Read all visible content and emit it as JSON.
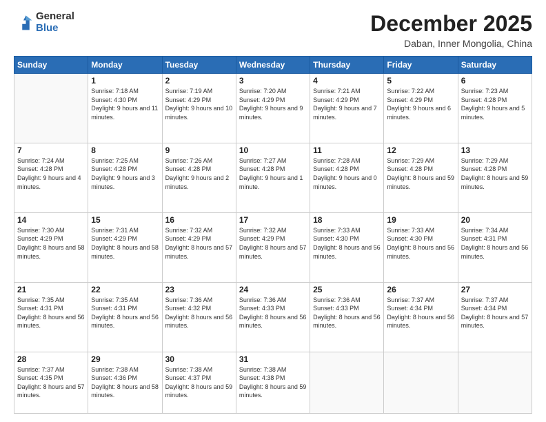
{
  "logo": {
    "general": "General",
    "blue": "Blue"
  },
  "header": {
    "month": "December 2025",
    "location": "Daban, Inner Mongolia, China"
  },
  "days_of_week": [
    "Sunday",
    "Monday",
    "Tuesday",
    "Wednesday",
    "Thursday",
    "Friday",
    "Saturday"
  ],
  "weeks": [
    [
      {
        "num": "",
        "sunrise": "",
        "sunset": "",
        "daylight": ""
      },
      {
        "num": "1",
        "sunrise": "Sunrise: 7:18 AM",
        "sunset": "Sunset: 4:30 PM",
        "daylight": "Daylight: 9 hours and 11 minutes."
      },
      {
        "num": "2",
        "sunrise": "Sunrise: 7:19 AM",
        "sunset": "Sunset: 4:29 PM",
        "daylight": "Daylight: 9 hours and 10 minutes."
      },
      {
        "num": "3",
        "sunrise": "Sunrise: 7:20 AM",
        "sunset": "Sunset: 4:29 PM",
        "daylight": "Daylight: 9 hours and 9 minutes."
      },
      {
        "num": "4",
        "sunrise": "Sunrise: 7:21 AM",
        "sunset": "Sunset: 4:29 PM",
        "daylight": "Daylight: 9 hours and 7 minutes."
      },
      {
        "num": "5",
        "sunrise": "Sunrise: 7:22 AM",
        "sunset": "Sunset: 4:29 PM",
        "daylight": "Daylight: 9 hours and 6 minutes."
      },
      {
        "num": "6",
        "sunrise": "Sunrise: 7:23 AM",
        "sunset": "Sunset: 4:28 PM",
        "daylight": "Daylight: 9 hours and 5 minutes."
      }
    ],
    [
      {
        "num": "7",
        "sunrise": "Sunrise: 7:24 AM",
        "sunset": "Sunset: 4:28 PM",
        "daylight": "Daylight: 9 hours and 4 minutes."
      },
      {
        "num": "8",
        "sunrise": "Sunrise: 7:25 AM",
        "sunset": "Sunset: 4:28 PM",
        "daylight": "Daylight: 9 hours and 3 minutes."
      },
      {
        "num": "9",
        "sunrise": "Sunrise: 7:26 AM",
        "sunset": "Sunset: 4:28 PM",
        "daylight": "Daylight: 9 hours and 2 minutes."
      },
      {
        "num": "10",
        "sunrise": "Sunrise: 7:27 AM",
        "sunset": "Sunset: 4:28 PM",
        "daylight": "Daylight: 9 hours and 1 minute."
      },
      {
        "num": "11",
        "sunrise": "Sunrise: 7:28 AM",
        "sunset": "Sunset: 4:28 PM",
        "daylight": "Daylight: 9 hours and 0 minutes."
      },
      {
        "num": "12",
        "sunrise": "Sunrise: 7:29 AM",
        "sunset": "Sunset: 4:28 PM",
        "daylight": "Daylight: 8 hours and 59 minutes."
      },
      {
        "num": "13",
        "sunrise": "Sunrise: 7:29 AM",
        "sunset": "Sunset: 4:28 PM",
        "daylight": "Daylight: 8 hours and 59 minutes."
      }
    ],
    [
      {
        "num": "14",
        "sunrise": "Sunrise: 7:30 AM",
        "sunset": "Sunset: 4:29 PM",
        "daylight": "Daylight: 8 hours and 58 minutes."
      },
      {
        "num": "15",
        "sunrise": "Sunrise: 7:31 AM",
        "sunset": "Sunset: 4:29 PM",
        "daylight": "Daylight: 8 hours and 58 minutes."
      },
      {
        "num": "16",
        "sunrise": "Sunrise: 7:32 AM",
        "sunset": "Sunset: 4:29 PM",
        "daylight": "Daylight: 8 hours and 57 minutes."
      },
      {
        "num": "17",
        "sunrise": "Sunrise: 7:32 AM",
        "sunset": "Sunset: 4:29 PM",
        "daylight": "Daylight: 8 hours and 57 minutes."
      },
      {
        "num": "18",
        "sunrise": "Sunrise: 7:33 AM",
        "sunset": "Sunset: 4:30 PM",
        "daylight": "Daylight: 8 hours and 56 minutes."
      },
      {
        "num": "19",
        "sunrise": "Sunrise: 7:33 AM",
        "sunset": "Sunset: 4:30 PM",
        "daylight": "Daylight: 8 hours and 56 minutes."
      },
      {
        "num": "20",
        "sunrise": "Sunrise: 7:34 AM",
        "sunset": "Sunset: 4:31 PM",
        "daylight": "Daylight: 8 hours and 56 minutes."
      }
    ],
    [
      {
        "num": "21",
        "sunrise": "Sunrise: 7:35 AM",
        "sunset": "Sunset: 4:31 PM",
        "daylight": "Daylight: 8 hours and 56 minutes."
      },
      {
        "num": "22",
        "sunrise": "Sunrise: 7:35 AM",
        "sunset": "Sunset: 4:31 PM",
        "daylight": "Daylight: 8 hours and 56 minutes."
      },
      {
        "num": "23",
        "sunrise": "Sunrise: 7:36 AM",
        "sunset": "Sunset: 4:32 PM",
        "daylight": "Daylight: 8 hours and 56 minutes."
      },
      {
        "num": "24",
        "sunrise": "Sunrise: 7:36 AM",
        "sunset": "Sunset: 4:33 PM",
        "daylight": "Daylight: 8 hours and 56 minutes."
      },
      {
        "num": "25",
        "sunrise": "Sunrise: 7:36 AM",
        "sunset": "Sunset: 4:33 PM",
        "daylight": "Daylight: 8 hours and 56 minutes."
      },
      {
        "num": "26",
        "sunrise": "Sunrise: 7:37 AM",
        "sunset": "Sunset: 4:34 PM",
        "daylight": "Daylight: 8 hours and 56 minutes."
      },
      {
        "num": "27",
        "sunrise": "Sunrise: 7:37 AM",
        "sunset": "Sunset: 4:34 PM",
        "daylight": "Daylight: 8 hours and 57 minutes."
      }
    ],
    [
      {
        "num": "28",
        "sunrise": "Sunrise: 7:37 AM",
        "sunset": "Sunset: 4:35 PM",
        "daylight": "Daylight: 8 hours and 57 minutes."
      },
      {
        "num": "29",
        "sunrise": "Sunrise: 7:38 AM",
        "sunset": "Sunset: 4:36 PM",
        "daylight": "Daylight: 8 hours and 58 minutes."
      },
      {
        "num": "30",
        "sunrise": "Sunrise: 7:38 AM",
        "sunset": "Sunset: 4:37 PM",
        "daylight": "Daylight: 8 hours and 59 minutes."
      },
      {
        "num": "31",
        "sunrise": "Sunrise: 7:38 AM",
        "sunset": "Sunset: 4:38 PM",
        "daylight": "Daylight: 8 hours and 59 minutes."
      },
      {
        "num": "",
        "sunrise": "",
        "sunset": "",
        "daylight": ""
      },
      {
        "num": "",
        "sunrise": "",
        "sunset": "",
        "daylight": ""
      },
      {
        "num": "",
        "sunrise": "",
        "sunset": "",
        "daylight": ""
      }
    ]
  ]
}
